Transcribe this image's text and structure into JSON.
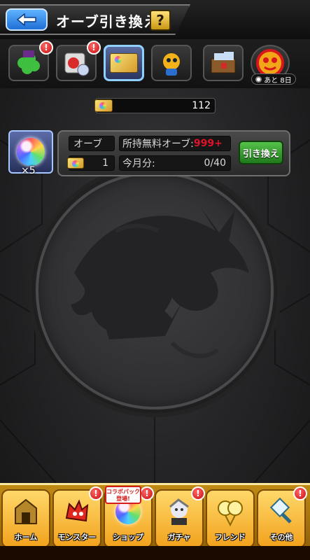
{
  "header": {
    "title": "オーブ引き換え",
    "help_label": "?"
  },
  "tabs": [
    {
      "name": "clover-tab",
      "badge": "!"
    },
    {
      "name": "potion-tab",
      "badge": "!"
    },
    {
      "name": "orb-ticket-tab",
      "badge": ""
    },
    {
      "name": "monster-tab",
      "badge": ""
    },
    {
      "name": "treasure-tab",
      "badge": ""
    },
    {
      "name": "event-tab",
      "badge": ""
    }
  ],
  "event_tab": {
    "days_left": "あと 8日"
  },
  "ticket_count": "112",
  "exchange": {
    "orb_label": "オーブ",
    "orb_quantity": "×5",
    "cost": "1",
    "free_orb_label": "所持無料オーブ:",
    "free_orb_value": "999+",
    "month_label": "今月分:",
    "month_value": "0/40",
    "button_label": "引き換え"
  },
  "bottom_nav": {
    "home": "ホーム",
    "monster": "モンスター",
    "shop": "ショップ",
    "gacha": "ガチャ",
    "friend": "フレンド",
    "other": "その他",
    "badge": "!",
    "collab_tag_line1": "コラボパック",
    "collab_tag_line2": "登場!"
  },
  "colors": {
    "accent_blue": "#1f6fd6",
    "exchange_green": "#1f7a1a",
    "price_red": "#e0122a",
    "nav_gold": "#f2a21d"
  }
}
